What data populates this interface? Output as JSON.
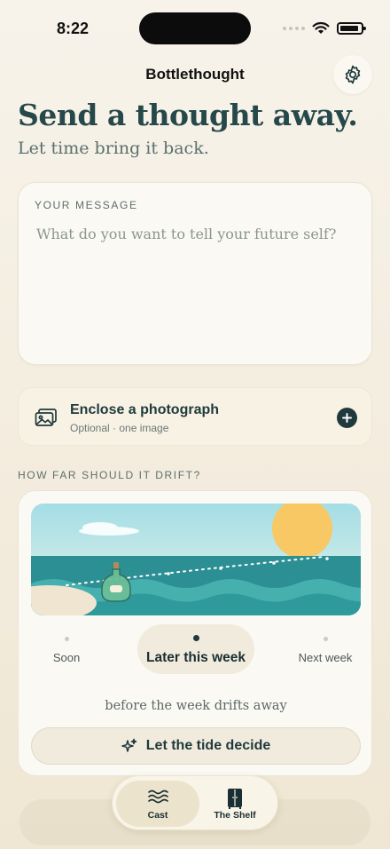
{
  "status_bar": {
    "time": "8:22"
  },
  "header": {
    "title": "Bottlethought"
  },
  "hero": {
    "headline": "Send a thought away.",
    "subline": "Let time bring it back."
  },
  "message": {
    "label": "YOUR MESSAGE",
    "placeholder": "What do you want to tell your future self?",
    "value": ""
  },
  "photo": {
    "title": "Enclose a photograph",
    "subtitle": "Optional · one image"
  },
  "drift": {
    "label": "HOW FAR SHOULD IT DRIFT?",
    "options": [
      {
        "label": "Soon",
        "selected": false
      },
      {
        "label": "Later this week",
        "selected": true
      },
      {
        "label": "Next week",
        "selected": false
      }
    ],
    "caption": "before the week drifts away",
    "tide_button": "Let the tide decide"
  },
  "tabbar": {
    "tabs": [
      {
        "label": "Cast",
        "icon": "waves-icon",
        "active": true
      },
      {
        "label": "The Shelf",
        "icon": "cabinet-icon",
        "active": false
      }
    ]
  },
  "colors": {
    "accent": "#1f3a3c",
    "sea": "#2f8f93",
    "sun": "#f7c864",
    "sky": "#a8dde4"
  }
}
